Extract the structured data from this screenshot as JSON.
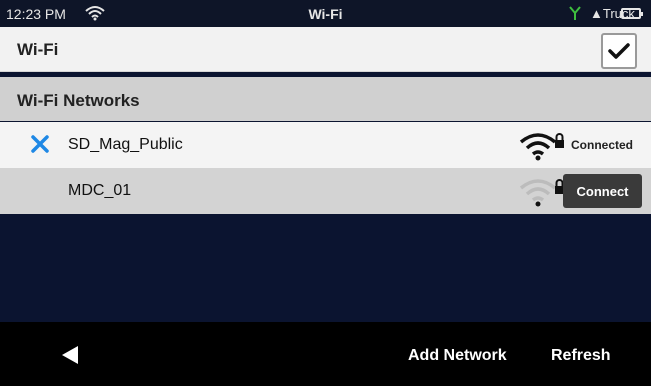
{
  "status_bar": {
    "time": "12:23 PM",
    "center_title": "Wi-Fi",
    "truck_label": "Truck",
    "wifi_icon": "wifi-icon",
    "antenna_icon": "antenna-icon",
    "battery_icon": "battery-icon",
    "accent_color": "#3fbf3f"
  },
  "header": {
    "title": "Wi-Fi",
    "toggle_checked": true
  },
  "section": {
    "label": "Wi-Fi Networks"
  },
  "networks": [
    {
      "name": "SD_Mag_Public",
      "selected": true,
      "secured": true,
      "status": "Connected"
    },
    {
      "name": "MDC_01",
      "selected": false,
      "secured": true,
      "action": "Connect"
    }
  ],
  "footer": {
    "back_icon": "back-arrow-icon",
    "add_network_label": "Add Network",
    "refresh_label": "Refresh"
  },
  "colors": {
    "check_mark": "#1e88e5",
    "connect_button": "#3a3a3a",
    "background": "#0b1430"
  }
}
